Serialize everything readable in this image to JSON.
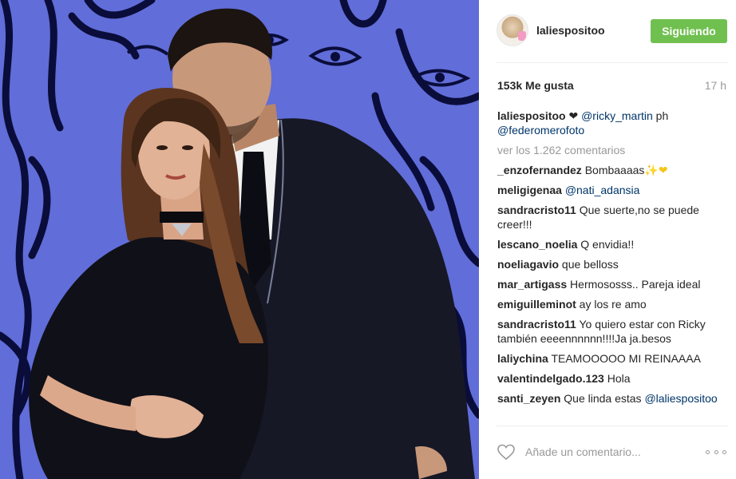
{
  "post": {
    "username": "laliespositoo",
    "follow_label": "Siguiendo",
    "likes": "153k Me gusta",
    "time": "17 h"
  },
  "caption": {
    "user": "laliespositoo",
    "heart": "❤",
    "mention1": "@ricky_martin",
    "text": " ph ",
    "mention2": "@federomerofoto"
  },
  "view_all": "ver los 1.262 comentarios",
  "comments": [
    {
      "user": "_enzofernandez",
      "text": " Bombaaaas",
      "extra": "✨❤"
    },
    {
      "user": "meligigenaa",
      "mention": "@nati_adansia"
    },
    {
      "user": "sandracristo11",
      "text": " Que suerte,no se puede creer!!!"
    },
    {
      "user": "lescano_noelia",
      "text": " Q envidia!!"
    },
    {
      "user": "noeliagavio",
      "text": " que belloss"
    },
    {
      "user": "mar_artigass",
      "text": " Hermososss.. Pareja ideal"
    },
    {
      "user": "emiguilleminot",
      "text": " ay los re amo"
    },
    {
      "user": "sandracristo11",
      "text": " Yo quiero estar con Ricky también eeeennnnnn!!!!Ja ja.besos"
    },
    {
      "user": "laliychina",
      "text": " TEAMOOOOO MI REINAAAA"
    },
    {
      "user": "valentindelgado.123",
      "text": " Hola"
    },
    {
      "user": "santi_zeyen",
      "text": " Que linda estas ",
      "mention": "@laliespositoo"
    }
  ],
  "footer": {
    "comment_placeholder": "Añade un comentario...",
    "like_icon": "heart-outline-icon",
    "more_icon": "more-options-icon"
  },
  "colors": {
    "follow_button": "#70c050",
    "mention": "#003569",
    "muted": "#999999",
    "photo_background": "#4a57c8"
  }
}
